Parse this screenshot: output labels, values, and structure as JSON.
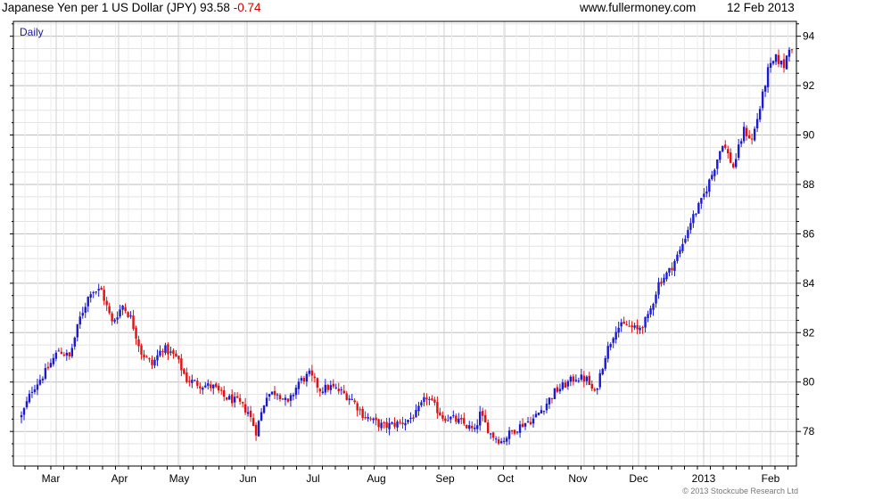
{
  "header": {
    "title": "Japanese Yen per 1 US Dollar (JPY)",
    "last": "93.58",
    "change": "-0.74",
    "source": "www.fullermoney.com",
    "date": "12 Feb 2013"
  },
  "chart_data": {
    "type": "candlestick",
    "periodicity": "Daily",
    "copyright": "© 2013 Stockcube Research Ltd",
    "y_axis": {
      "min": 76.6,
      "max": 94.6,
      "ticks": [
        78,
        80,
        82,
        84,
        86,
        88,
        90,
        92,
        94
      ],
      "tick_labels": [
        "78",
        "80",
        "82",
        "84",
        "86",
        "88",
        "90",
        "92",
        "94"
      ]
    },
    "x_axis": {
      "labels": [
        "Mar",
        "Apr",
        "May",
        "Jun",
        "Jul",
        "Aug",
        "Sep",
        "Oct",
        "Nov",
        "Dec",
        "2013",
        "Feb"
      ]
    },
    "up_color": "#1a1ad0",
    "down_color": "#e01010",
    "close_anchors": [
      [
        0,
        78.6
      ],
      [
        4,
        79.7
      ],
      [
        9,
        80.4
      ],
      [
        14,
        81.3
      ],
      [
        18,
        81.0
      ],
      [
        22,
        82.6
      ],
      [
        26,
        83.7
      ],
      [
        30,
        83.7
      ],
      [
        34,
        82.4
      ],
      [
        38,
        83.1
      ],
      [
        41,
        82.6
      ],
      [
        45,
        81.2
      ],
      [
        49,
        80.7
      ],
      [
        53,
        81.4
      ],
      [
        58,
        81.0
      ],
      [
        62,
        80.1
      ],
      [
        67,
        79.9
      ],
      [
        72,
        79.8
      ],
      [
        76,
        79.4
      ],
      [
        81,
        79.2
      ],
      [
        85,
        78.8
      ],
      [
        88,
        78.0
      ],
      [
        92,
        79.5
      ],
      [
        96,
        79.6
      ],
      [
        100,
        79.1
      ],
      [
        104,
        80.0
      ],
      [
        108,
        80.3
      ],
      [
        112,
        79.7
      ],
      [
        116,
        79.8
      ],
      [
        120,
        79.6
      ],
      [
        124,
        79.3
      ],
      [
        128,
        78.7
      ],
      [
        132,
        78.4
      ],
      [
        136,
        78.2
      ],
      [
        140,
        78.3
      ],
      [
        144,
        78.4
      ],
      [
        148,
        78.7
      ],
      [
        152,
        79.4
      ],
      [
        155,
        79.0
      ],
      [
        158,
        78.6
      ],
      [
        162,
        78.5
      ],
      [
        166,
        78.3
      ],
      [
        170,
        78.0
      ],
      [
        172,
        78.7
      ],
      [
        176,
        77.9
      ],
      [
        180,
        77.6
      ],
      [
        184,
        78.0
      ],
      [
        188,
        78.3
      ],
      [
        192,
        78.5
      ],
      [
        196,
        79.0
      ],
      [
        200,
        79.6
      ],
      [
        204,
        79.9
      ],
      [
        208,
        80.2
      ],
      [
        212,
        80.1
      ],
      [
        215,
        79.5
      ],
      [
        219,
        81.1
      ],
      [
        223,
        82.2
      ],
      [
        227,
        82.3
      ],
      [
        231,
        82.1
      ],
      [
        235,
        82.6
      ],
      [
        239,
        84.0
      ],
      [
        243,
        84.5
      ],
      [
        247,
        85.3
      ],
      [
        251,
        86.5
      ],
      [
        255,
        87.3
      ],
      [
        259,
        88.4
      ],
      [
        263,
        89.7
      ],
      [
        267,
        88.7
      ],
      [
        271,
        90.2
      ],
      [
        274,
        89.8
      ],
      [
        277,
        91.1
      ],
      [
        280,
        92.6
      ],
      [
        283,
        93.1
      ],
      [
        286,
        92.8
      ],
      [
        288,
        93.6
      ]
    ]
  }
}
